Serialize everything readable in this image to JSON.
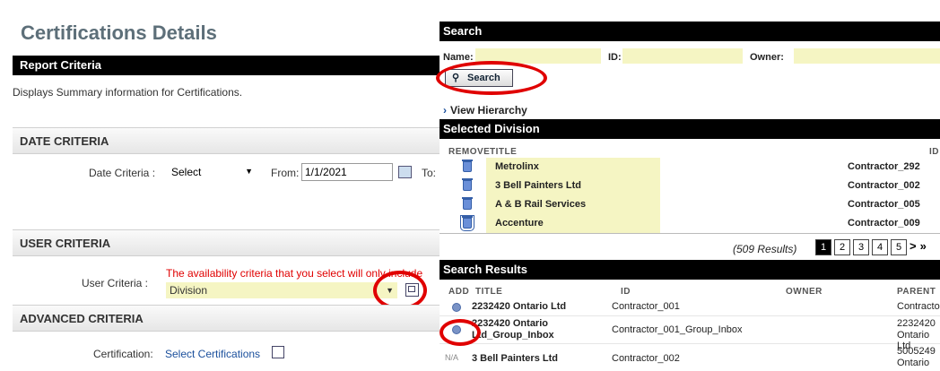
{
  "left": {
    "title": "Certifications Details",
    "report_criteria": "Report Criteria",
    "description": "Displays Summary information for Certifications.",
    "date_criteria": {
      "header": "DATE CRITERIA",
      "label": "Date Criteria :",
      "select_value": "Select",
      "from_label": "From:",
      "from_value": "1/1/2021",
      "to_label": "To:"
    },
    "user_criteria": {
      "header": "USER CRITERIA",
      "label": "User Criteria :",
      "note": "The availability criteria that you select will only include",
      "select_value": "Division"
    },
    "advanced_criteria": {
      "header": "ADVANCED CRITERIA",
      "cert_label": "Certification:",
      "cert_link": "Select Certifications"
    }
  },
  "right": {
    "search": {
      "header": "Search",
      "name_label": "Name:",
      "id_label": "ID:",
      "owner_label": "Owner:",
      "button_label": "Search"
    },
    "view_hierarchy": "View Hierarchy",
    "selected_division": {
      "header": "Selected Division",
      "col_remove": "REMOVE",
      "col_title": "TITLE",
      "col_id": "ID",
      "rows": [
        {
          "title": "Metrolinx",
          "id": "Contractor_292"
        },
        {
          "title": "3 Bell Painters Ltd",
          "id": "Contractor_002"
        },
        {
          "title": "A & B Rail Services",
          "id": "Contractor_005"
        },
        {
          "title": "Accenture",
          "id": "Contractor_009"
        }
      ],
      "results": "(509 Results)",
      "pages": [
        "1",
        "2",
        "3",
        "4",
        "5"
      ],
      "next": ">",
      "last": "»"
    },
    "search_results": {
      "header": "Search Results",
      "col_add": "ADD",
      "col_title": "TITLE",
      "col_id": "ID",
      "col_owner": "OWNER",
      "col_parent": "PARENT",
      "rows": [
        {
          "title": "2232420 Ontario Ltd",
          "id": "Contractor_001",
          "owner": "",
          "parent": "Contractors"
        },
        {
          "title_line1": "2232420 Ontario",
          "title_line2": "Ltd_Group_Inbox",
          "id": "Contractor_001_Group_Inbox",
          "owner": "",
          "parent_line1": "2232420",
          "parent_line2": "Ontario Ltd"
        },
        {
          "title": "3 Bell Painters Ltd",
          "id": "Contractor_002",
          "owner": "",
          "parent_line1": "5005249",
          "parent_line2": "Ontario"
        }
      ]
    }
  },
  "colors": {
    "accent_red": "#e00000",
    "highlight_yellow": "#f5f5c3",
    "header_black": "#000000",
    "title_gray": "#5d6f79"
  }
}
